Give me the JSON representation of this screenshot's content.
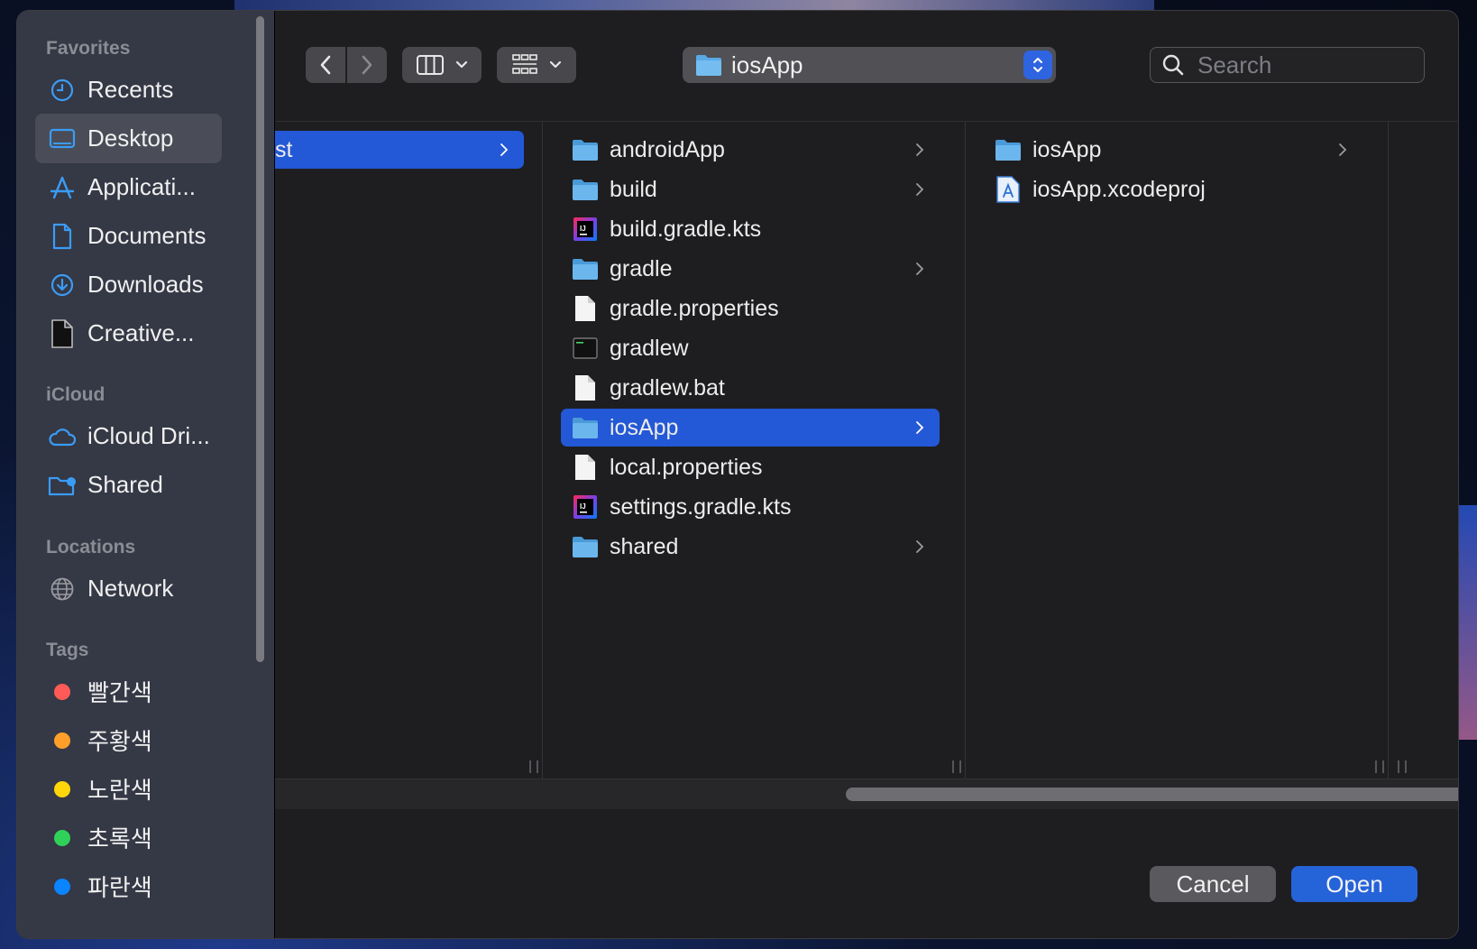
{
  "sidebar": {
    "favorites_header": "Favorites",
    "favorites": [
      {
        "label": "Recents",
        "icon": "clock-icon"
      },
      {
        "label": "Desktop",
        "icon": "desktop-icon"
      },
      {
        "label": "Applicati...",
        "icon": "applications-icon"
      },
      {
        "label": "Documents",
        "icon": "document-icon"
      },
      {
        "label": "Downloads",
        "icon": "download-icon"
      },
      {
        "label": "Creative...",
        "icon": "file-icon"
      }
    ],
    "icloud_header": "iCloud",
    "icloud": [
      {
        "label": "iCloud Dri...",
        "icon": "cloud-icon"
      },
      {
        "label": "Shared",
        "icon": "shared-folder-icon"
      }
    ],
    "locations_header": "Locations",
    "locations": [
      {
        "label": "Network",
        "icon": "globe-icon"
      }
    ],
    "tags_header": "Tags",
    "tags": [
      {
        "label": "빨간색",
        "color": "#ff5a57"
      },
      {
        "label": "주황색",
        "color": "#ff9f2a"
      },
      {
        "label": "노란색",
        "color": "#ffd60a"
      },
      {
        "label": "초록색",
        "color": "#30d158"
      },
      {
        "label": "파란색",
        "color": "#0a84ff"
      }
    ]
  },
  "toolbar": {
    "path_label": "iosApp",
    "search_placeholder": "Search"
  },
  "columns": {
    "col1_selected": "st",
    "col2": [
      {
        "label": "androidApp",
        "type": "folder",
        "chevron": true
      },
      {
        "label": "build",
        "type": "folder",
        "chevron": true
      },
      {
        "label": "build.gradle.kts",
        "type": "intellij",
        "chevron": false
      },
      {
        "label": "gradle",
        "type": "folder",
        "chevron": true
      },
      {
        "label": "gradle.properties",
        "type": "doc",
        "chevron": false
      },
      {
        "label": "gradlew",
        "type": "exec",
        "chevron": false
      },
      {
        "label": "gradlew.bat",
        "type": "doc",
        "chevron": false
      },
      {
        "label": "iosApp",
        "type": "folder",
        "chevron": true,
        "selected": true
      },
      {
        "label": "local.properties",
        "type": "doc",
        "chevron": false
      },
      {
        "label": "settings.gradle.kts",
        "type": "intellij",
        "chevron": false
      },
      {
        "label": "shared",
        "type": "folder",
        "chevron": true
      }
    ],
    "col3": [
      {
        "label": "iosApp",
        "type": "folder",
        "chevron": true
      },
      {
        "label": "iosApp.xcodeproj",
        "type": "xcode",
        "chevron": false
      }
    ]
  },
  "footer": {
    "cancel_label": "Cancel",
    "open_label": "Open"
  },
  "colors": {
    "accent": "#2358d6",
    "folder": "#5aa9e6"
  }
}
